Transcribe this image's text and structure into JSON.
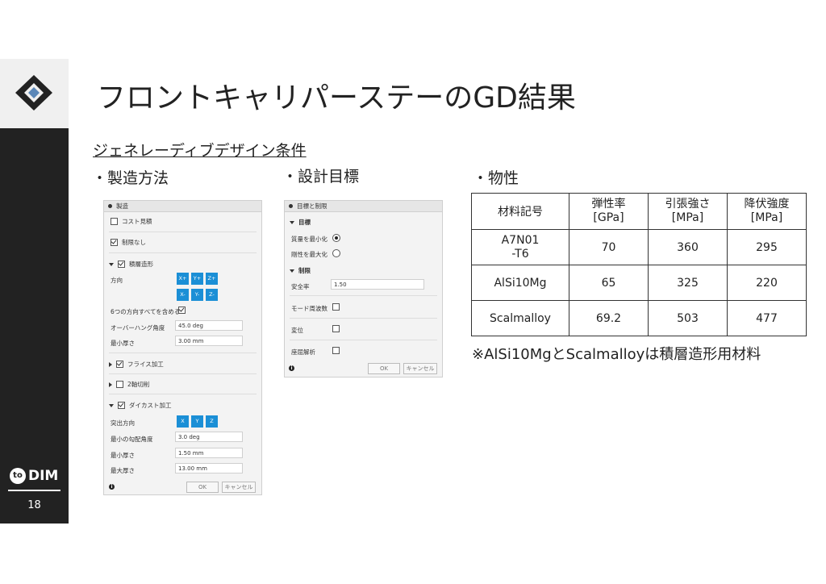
{
  "title": "フロントキャリパーステーのGD結果",
  "subheading": "ジェネレーディブデザイン条件",
  "sections": {
    "manufacturing": "・製造方法",
    "objectives": "・設計目標",
    "properties": "・物性"
  },
  "sidebar": {
    "brand": "DIM",
    "brand_prefix": "to",
    "page_number": "18"
  },
  "manufacturing_panel": {
    "title": "製造",
    "cost_estimate": "コスト見積",
    "unrestricted": "制限なし",
    "additive": "積層造形",
    "direction_label": "方向",
    "direction_buttons": [
      "X+",
      "Y+",
      "Z+",
      "X-",
      "Y-",
      "Z-"
    ],
    "all_six": "6つの方向すべてを含める",
    "overhang_label": "オーバーハング角度",
    "overhang_value": "45.0 deg",
    "min_thickness_label": "最小厚さ",
    "min_thickness_value": "3.00 mm",
    "milling": "フライス加工",
    "two_axis": "2軸切削",
    "die_casting": "ダイカスト加工",
    "eject_label": "突出方向",
    "eject_buttons": [
      "X",
      "Y",
      "Z"
    ],
    "draft_label": "最小の勾配角度",
    "draft_value": "3.0 deg",
    "cast_min_label": "最小厚さ",
    "cast_min_value": "1.50 mm",
    "cast_max_label": "最大厚さ",
    "cast_max_value": "13.00 mm",
    "ok": "OK",
    "cancel": "キャンセル"
  },
  "objectives_panel": {
    "title": "目標と制限",
    "objective_header": "目標",
    "minimize_mass": "質量を最小化",
    "maximize_stiffness": "剛性を最大化",
    "limits_header": "制限",
    "safety_factor_label": "安全率",
    "safety_factor_value": "1.50",
    "mode_freq": "モード周波数",
    "displacement": "変位",
    "buckling": "座屈解析",
    "ok": "OK",
    "cancel": "キャンセル"
  },
  "table": {
    "headers": [
      [
        "材料記号"
      ],
      [
        "弾性率",
        "[GPa]"
      ],
      [
        "引張強さ",
        "[MPa]"
      ],
      [
        "降伏強度",
        "[MPa]"
      ]
    ],
    "rows": [
      {
        "name": [
          "A7N01",
          "-T6"
        ],
        "elastic": "70",
        "tensile": "360",
        "yield": "295"
      },
      {
        "name": [
          "AlSi10Mg"
        ],
        "elastic": "65",
        "tensile": "325",
        "yield": "220"
      },
      {
        "name": [
          "Scalmalloy"
        ],
        "elastic": "69.2",
        "tensile": "503",
        "yield": "477"
      }
    ]
  },
  "note": "※AlSi10MgとScalmalloyは積層造形用材料",
  "colors": {
    "sidebar": "#222222",
    "accent_blue": "#1b8fd6",
    "logo_blue": "#5b87b8"
  }
}
